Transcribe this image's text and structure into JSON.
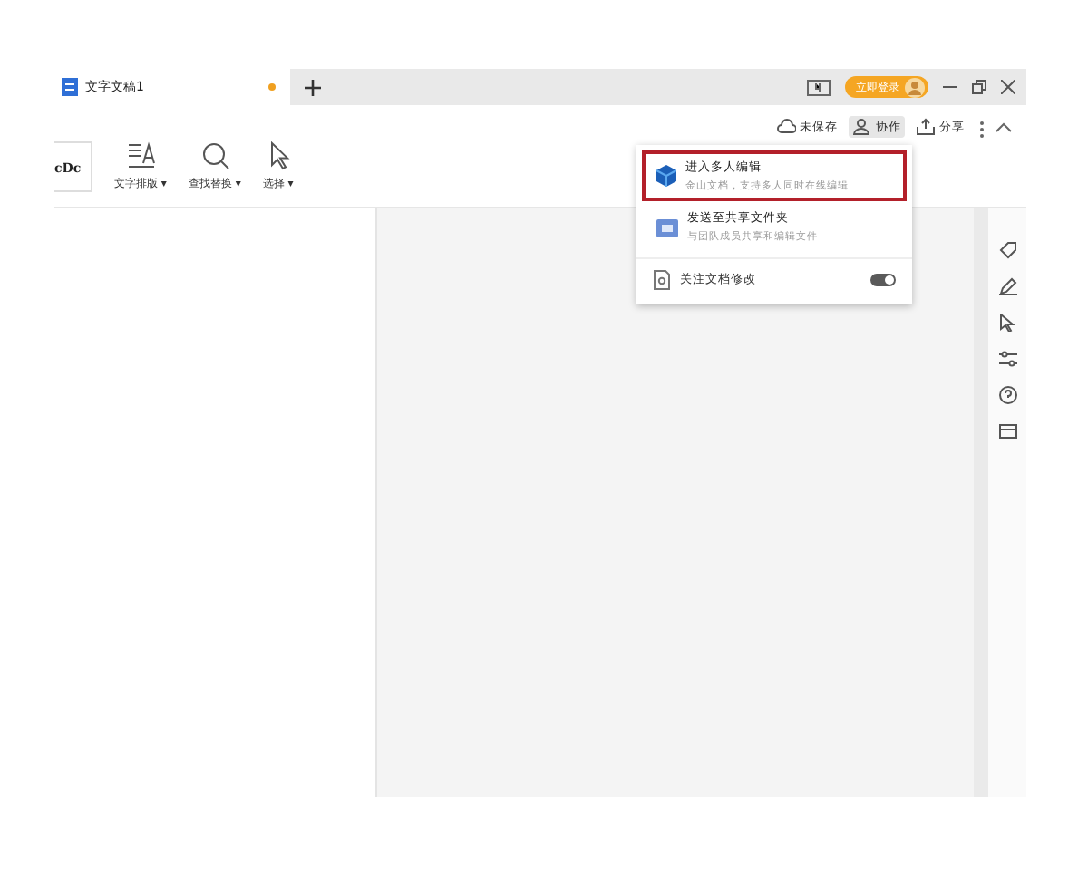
{
  "tab": {
    "title": "文字文稿1",
    "modified": true
  },
  "login_badge": "立即登录",
  "toolbar": {
    "style_sample": "cDc",
    "tools": [
      {
        "label": "文字排版 ▾",
        "kind": "layout"
      },
      {
        "label": "查找替换 ▾",
        "kind": "search"
      },
      {
        "label": "选择 ▾",
        "kind": "select"
      }
    ]
  },
  "actions": [
    {
      "label": "未保存",
      "kind": "cloud",
      "selected": false
    },
    {
      "label": "协作",
      "kind": "people",
      "selected": true
    },
    {
      "label": "分享",
      "kind": "share",
      "selected": false
    }
  ],
  "menu": {
    "items": [
      {
        "kind": "entry",
        "title": "进入多人编辑",
        "subtitle": "金山文档，支持多人同时在线编辑",
        "highlighted": true
      },
      {
        "kind": "entry",
        "title": "发送至共享文件夹",
        "subtitle": "与团队成员共享和编辑文件",
        "highlighted": false
      },
      {
        "kind": "toggle",
        "title": "关注文档修改",
        "on": true
      }
    ]
  }
}
